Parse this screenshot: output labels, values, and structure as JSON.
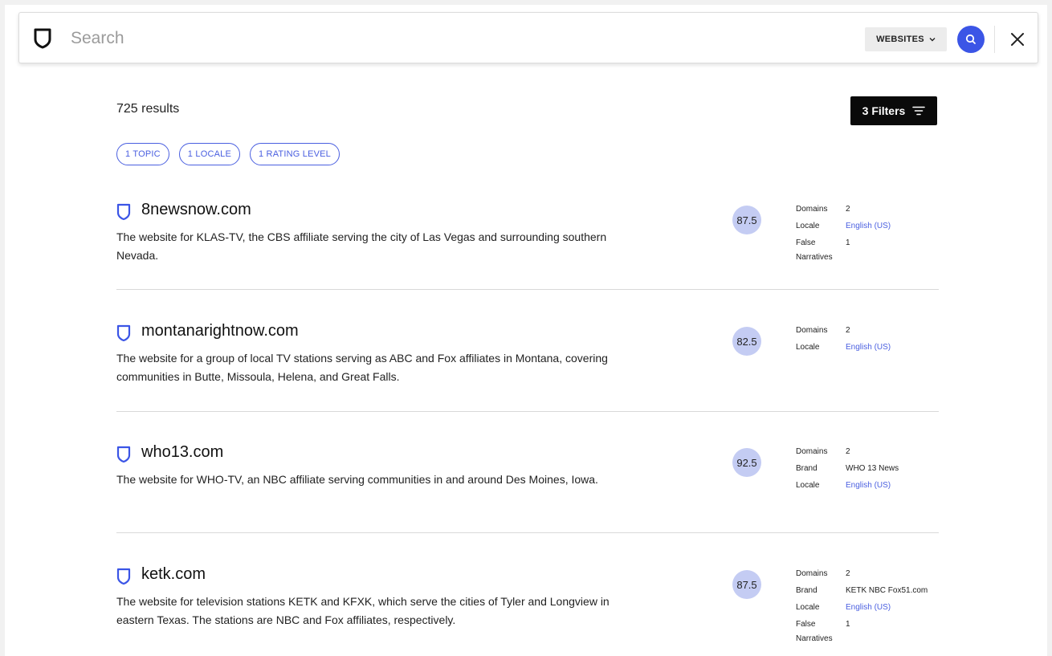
{
  "search": {
    "placeholder": "Search",
    "type_select": "WEBSITES",
    "close_label": "×"
  },
  "results_header": {
    "count": "725 results",
    "filters_label": "3 Filters"
  },
  "chips": [
    "1 TOPIC",
    "1 LOCALE",
    "1 RATING LEVEL"
  ],
  "results": [
    {
      "domain": "8newsnow.com",
      "description": "The website for KLAS-TV, the CBS affiliate serving the city of Las Vegas and surrounding southern Nevada.",
      "score": "87.5",
      "meta": [
        {
          "key": "Domains",
          "value": "2",
          "link": false
        },
        {
          "key": "Locale",
          "value": "English (US)",
          "link": true
        },
        {
          "key": "False Narratives",
          "value": "1",
          "link": false
        }
      ]
    },
    {
      "domain": "montanarightnow.com",
      "description": "The website for a group of local TV stations serving as ABC and Fox affiliates in Montana, covering communities in Butte, Missoula, Helena, and Great Falls.",
      "score": "82.5",
      "meta": [
        {
          "key": "Domains",
          "value": "2",
          "link": false
        },
        {
          "key": "Locale",
          "value": "English (US)",
          "link": true
        }
      ]
    },
    {
      "domain": "who13.com",
      "description": "The website for WHO-TV, an NBC affiliate serving communities in and around Des Moines, Iowa.",
      "score": "92.5",
      "meta": [
        {
          "key": "Domains",
          "value": "2",
          "link": false
        },
        {
          "key": "Brand",
          "value": "WHO 13 News",
          "link": false
        },
        {
          "key": "Locale",
          "value": "English (US)",
          "link": true
        }
      ]
    },
    {
      "domain": "ketk.com",
      "description": "The website for television stations KETK and KFXK, which serve the cities of Tyler and Longview in eastern Texas. The stations are NBC and Fox affiliates, respectively.",
      "score": "87.5",
      "meta": [
        {
          "key": "Domains",
          "value": "2",
          "link": false
        },
        {
          "key": "Brand",
          "value": "KETK NBC Fox51.com",
          "link": false
        },
        {
          "key": "Locale",
          "value": "English (US)",
          "link": true
        },
        {
          "key": "False Narratives",
          "value": "1",
          "link": false
        }
      ]
    }
  ],
  "colors": {
    "accent": "#3b55e6",
    "chip": "#4a5fe0",
    "score_bg": "#c4ccf3",
    "filters_bg": "#0a0a0a"
  }
}
